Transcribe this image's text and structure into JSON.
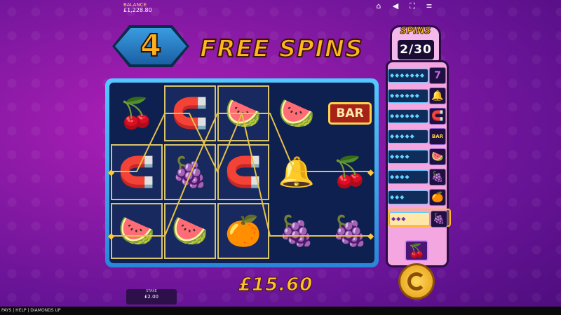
{
  "balance": {
    "label": "BALANCE",
    "value": "£1,228.80"
  },
  "top_icons": [
    "home-icon",
    "speaker-icon",
    "fullscreen-icon",
    "menu-icon"
  ],
  "free_spins": {
    "count": "4",
    "title": "FREE SPINS"
  },
  "spins_counter": {
    "label": "SPINS",
    "value": "2/30"
  },
  "reels": [
    [
      "cherry",
      "horseshoe",
      "watermelon"
    ],
    [
      "horseshoe",
      "plum",
      "watermelon"
    ],
    [
      "watermelon",
      "horseshoe",
      "orange"
    ],
    [
      "watermelon",
      "bell",
      "grapes"
    ],
    [
      "bar",
      "cherry",
      "plum"
    ]
  ],
  "bar_label": "BAR",
  "ladder": [
    {
      "gems": "◆◆◆◆◆◆◆",
      "symbol": "seven"
    },
    {
      "gems": "◆◆◆◆◆◆",
      "symbol": "bell"
    },
    {
      "gems": "◆◆◆◆◆◆",
      "symbol": "horseshoe"
    },
    {
      "gems": "◆◆◆◆◆",
      "symbol": "bar"
    },
    {
      "gems": "◆◆◆◆",
      "symbol": "watermelon"
    },
    {
      "gems": "◆◆◆◆",
      "symbol": "grapes"
    },
    {
      "gems": "◆◆◆",
      "symbol": "orange"
    },
    {
      "gems": "◆◆◆",
      "symbol": "plum",
      "active": true
    }
  ],
  "ladder_bottom_symbol": "cherry",
  "win": {
    "amount": "£15.60"
  },
  "stake": {
    "label": "STAKE",
    "value": "£2.00"
  },
  "bottom_bar": {
    "text": "PAYS | HELP | DIAMONDS UP"
  },
  "colors": {
    "gold": "#ffb61f",
    "background": "#8a1aa6",
    "reel_frame": "#53c9ff",
    "payline": "#e6c24a"
  }
}
